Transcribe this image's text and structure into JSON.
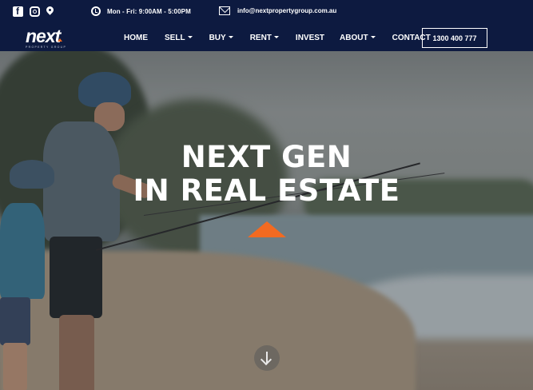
{
  "topbar": {
    "social_icons": [
      "facebook-icon",
      "instagram-icon",
      "location-pin-icon"
    ],
    "hours": "Mon - Fri: 9:00AM - 5:00PM",
    "email": "info@nextpropertygroup.com.au"
  },
  "logo": {
    "text": "next",
    "sub": "PROPERTY GROUP"
  },
  "nav": {
    "items": [
      {
        "label": "HOME",
        "has_dropdown": false
      },
      {
        "label": "SELL",
        "has_dropdown": true
      },
      {
        "label": "BUY",
        "has_dropdown": true
      },
      {
        "label": "RENT",
        "has_dropdown": true
      },
      {
        "label": "INVEST",
        "has_dropdown": false
      },
      {
        "label": "ABOUT",
        "has_dropdown": true
      },
      {
        "label": "CONTACT",
        "has_dropdown": false
      }
    ],
    "phone": "1300 400 777"
  },
  "hero": {
    "line1": "NEXT GEN",
    "line2": "IN REAL ESTATE"
  },
  "colors": {
    "navy": "#0d1a40",
    "accent": "#f26a21"
  }
}
